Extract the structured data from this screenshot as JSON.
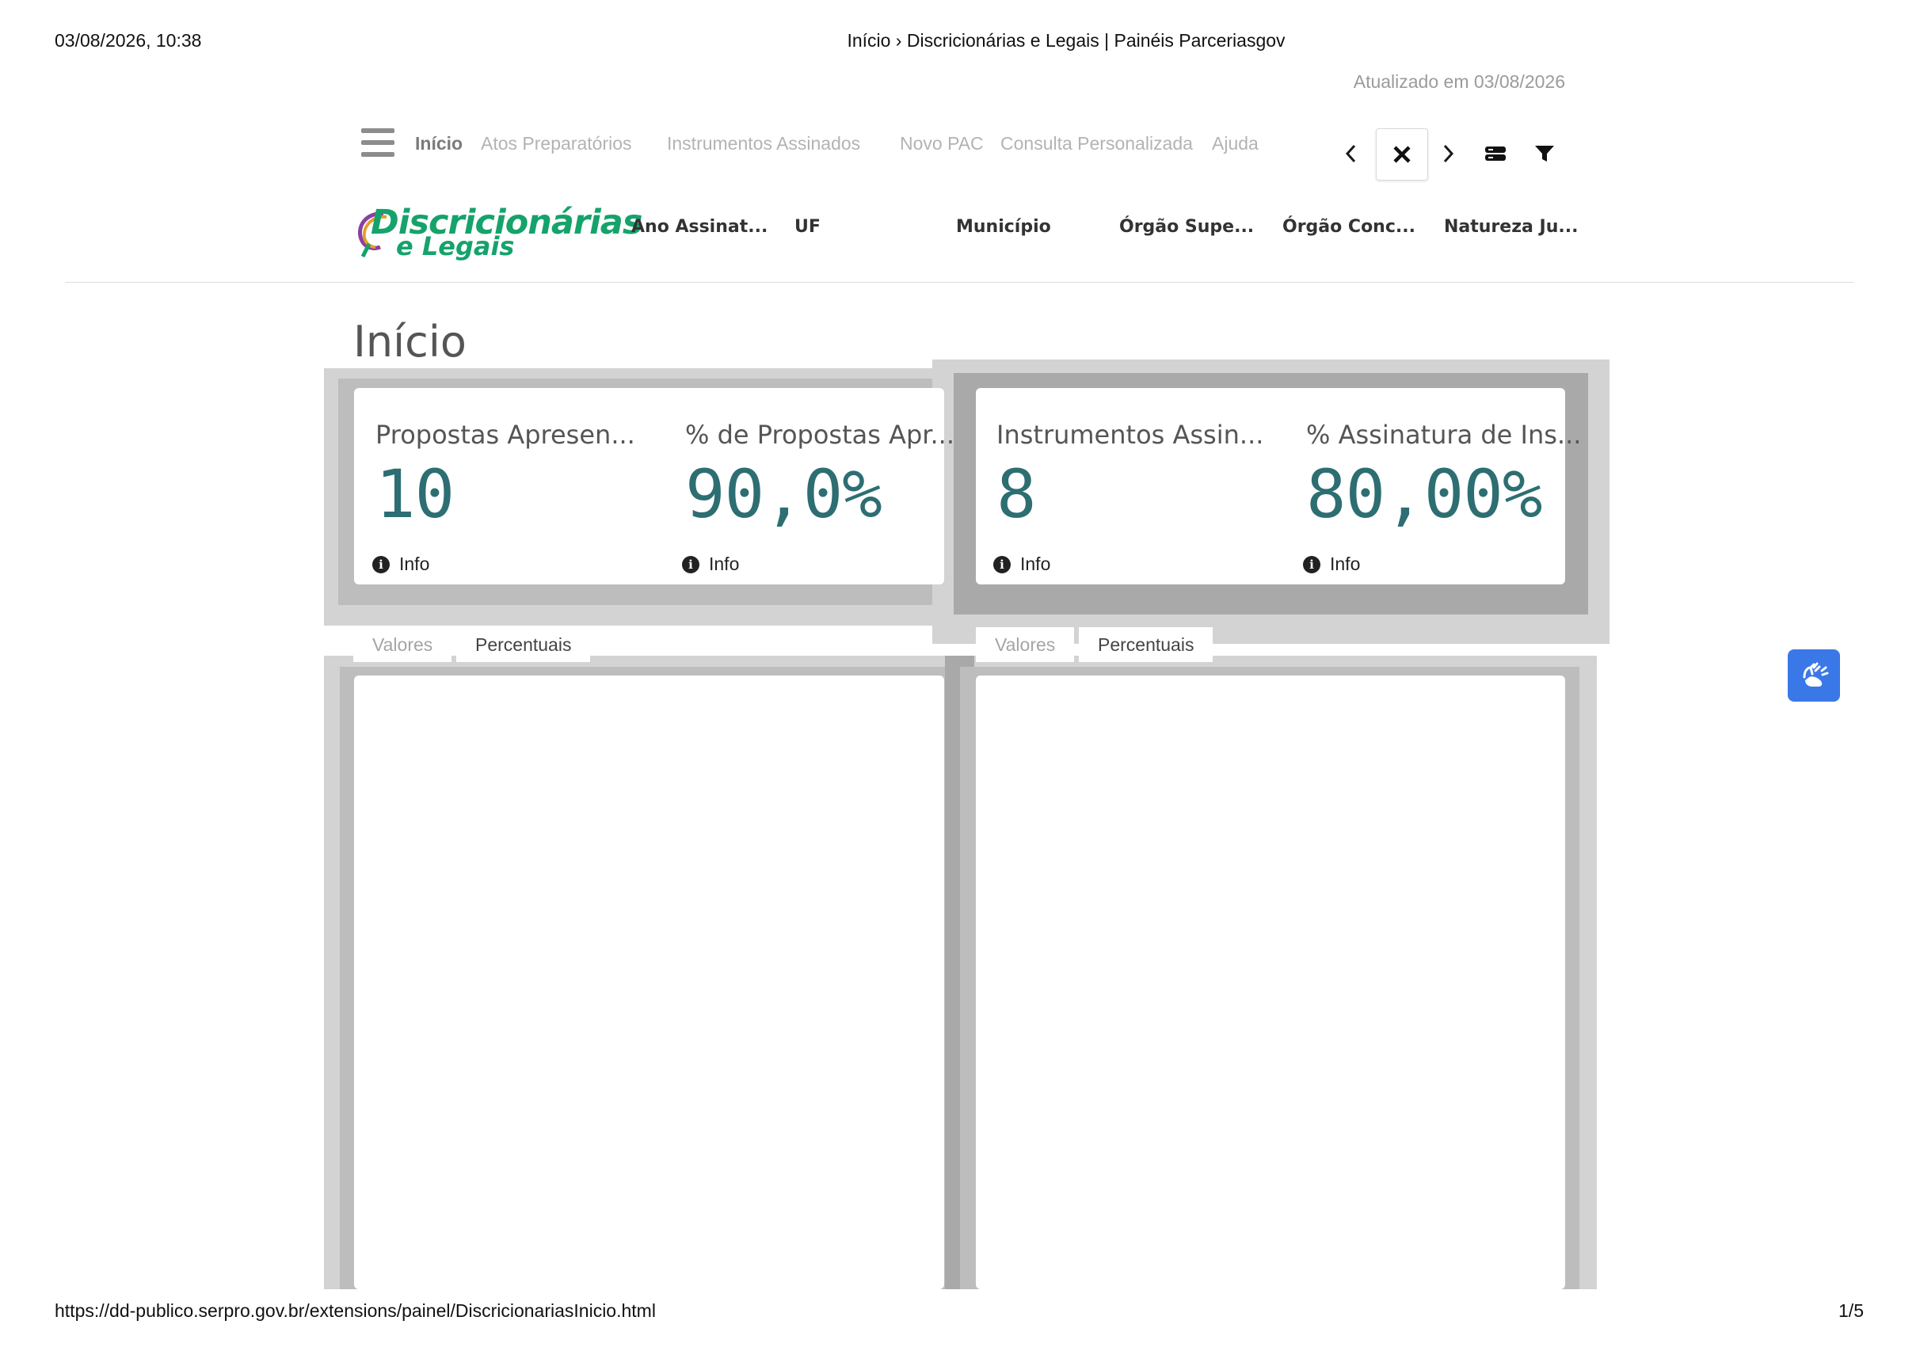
{
  "print": {
    "datetime": "03/08/2026, 10:38",
    "title": "Início › Discricionárias e Legais | Painéis Parceriasgov",
    "url": "https://dd-publico.serpro.gov.br/extensions/painel/DiscricionariasInicio.html",
    "page": "1/5"
  },
  "updated": "Atualizado em 03/08/2026",
  "nav": {
    "items": [
      {
        "label": "Início"
      },
      {
        "label": "Atos Preparatórios"
      },
      {
        "label": "Instrumentos Assinados"
      },
      {
        "label": "Novo PAC"
      },
      {
        "label": "Consulta Personalizada"
      },
      {
        "label": "Ajuda"
      }
    ],
    "tools": [
      "chevron-left-icon",
      "close-icon",
      "chevron-right-icon",
      "selections-icon",
      "filter-icon"
    ]
  },
  "logo": {
    "line1": "Discricionárias",
    "line2": "e Legais"
  },
  "filters": [
    "Ano Assinat...",
    "UF",
    "Município",
    "Órgão Supe...",
    "Órgão Conc...",
    "Natureza Ju..."
  ],
  "page_title": "Início",
  "kpis": [
    {
      "label": "Propostas Apresen...",
      "value": "10",
      "info": "Info"
    },
    {
      "label": "% de Propostas Apr...",
      "value": "90,0%",
      "info": "Info"
    },
    {
      "label": "Instrumentos Assin...",
      "value": "8",
      "info": "Info"
    },
    {
      "label": "% Assinatura de Ins...",
      "value": "80,00%",
      "info": "Info"
    }
  ],
  "tabs_left": {
    "values": "Valores",
    "percent": "Percentuais"
  },
  "tabs_right": {
    "values": "Valores",
    "percent": "Percentuais"
  },
  "colors": {
    "kpi_value": "#2d6e72",
    "brand_green": "#15a36b",
    "a11y_blue": "#3a78e7"
  }
}
